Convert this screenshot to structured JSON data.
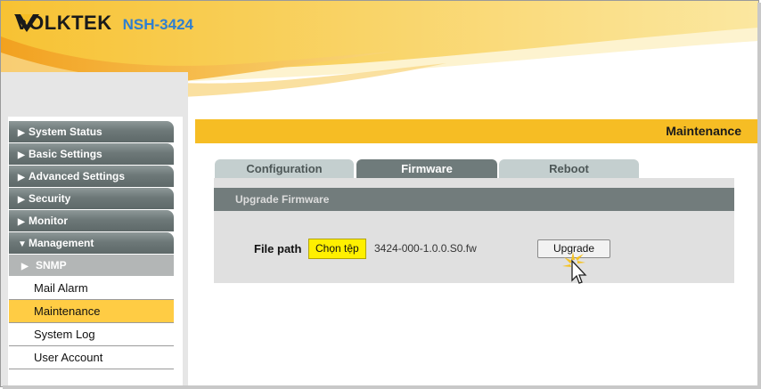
{
  "header": {
    "brand": "VOLKTEK",
    "model": "NSH-3424",
    "logo_icon": "volktek-chevron-logo",
    "colors": {
      "accent": "#f6bd24",
      "brand_text": "#1a1a1a",
      "model_text": "#2f7fd0"
    }
  },
  "sidebar": {
    "items": [
      {
        "label": "System Status",
        "icon": "triangle-right-icon"
      },
      {
        "label": "Basic Settings",
        "icon": "triangle-right-icon"
      },
      {
        "label": "Advanced Settings",
        "icon": "triangle-right-icon"
      },
      {
        "label": "Security",
        "icon": "triangle-right-icon"
      },
      {
        "label": "Monitor",
        "icon": "triangle-right-icon"
      },
      {
        "label": "Management",
        "icon": "triangle-down-icon"
      }
    ],
    "submenu": {
      "label": "SNMP",
      "icon": "triangle-right-icon"
    },
    "leaves": [
      {
        "label": "Mail Alarm",
        "active": false
      },
      {
        "label": "Maintenance",
        "active": true
      },
      {
        "label": "System Log",
        "active": false
      },
      {
        "label": "User Account",
        "active": false
      }
    ]
  },
  "main": {
    "title": "Maintenance",
    "tabs": [
      {
        "label": "Configuration",
        "active": false
      },
      {
        "label": "Firmware",
        "active": true
      },
      {
        "label": "Reboot",
        "active": false
      }
    ],
    "section_title": "Upgrade Firmware",
    "file_path_label": "File path",
    "choose_file_label": "Chọn tệp",
    "file_name": "3424-000-1.0.0.S0.fw",
    "upgrade_label": "Upgrade"
  }
}
